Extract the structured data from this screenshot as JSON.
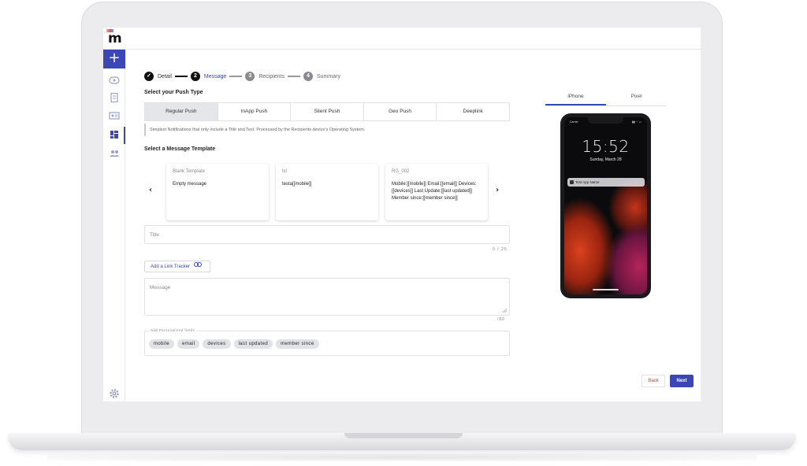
{
  "brand": {
    "logo_letter": "m",
    "accent": "#3b47b4"
  },
  "sidebar": {
    "create_label": "+",
    "items": [
      {
        "icon": "dashboard-icon"
      },
      {
        "icon": "document-icon"
      },
      {
        "icon": "contacts-icon"
      },
      {
        "icon": "grid-icon",
        "active": true
      },
      {
        "icon": "users-icon"
      }
    ],
    "settings_icon": "gear-icon"
  },
  "stepper": {
    "steps": [
      {
        "num": "✓",
        "label": "Detail",
        "state": "done"
      },
      {
        "num": "2",
        "label": "Message",
        "state": "active"
      },
      {
        "num": "3",
        "label": "Recipients",
        "state": "todo"
      },
      {
        "num": "4",
        "label": "Summary",
        "state": "todo"
      }
    ]
  },
  "push_type": {
    "heading": "Select your Push Type",
    "tabs": [
      "Regular Push",
      "InApp Push",
      "Silent Push",
      "Geo Push",
      "Deeplink"
    ],
    "selected": "Regular Push",
    "info": "Simplest Notifications that only include a Title and Text. Processed by the Recipients device's Operating System."
  },
  "templates": {
    "heading": "Select a Message Template",
    "prev_arrow": "‹",
    "next_arrow": "›",
    "cards": [
      {
        "name": "Blank Template",
        "body": "Empty message"
      },
      {
        "name": "txt",
        "body": "testa[[mobile]]"
      },
      {
        "name": "RG_002",
        "body": "Mobile:[[mobile]] Email:[[email]] Devices:[[devices]] Last Update:[[last updated]] Member since:[[member since]]"
      }
    ]
  },
  "title_field": {
    "placeholder": "Title",
    "counter": "0 / 25"
  },
  "link_tracker": {
    "label": "Add a Link Tracker"
  },
  "message_field": {
    "placeholder": "Message",
    "counter": "/80"
  },
  "personalized": {
    "label": "Add Personalized fields",
    "chips": [
      "mobile",
      "email",
      "devices",
      "last updated",
      "member since"
    ]
  },
  "preview": {
    "tabs": [
      "iPhone",
      "Pixel"
    ],
    "selected": "iPhone",
    "carrier": "Carrier",
    "status": "▮▮ ◠ ▭",
    "time": "15:52",
    "date": "Sunday, March 28",
    "notification": "Test App Name"
  },
  "actions": {
    "back": "Back",
    "next": "Next"
  }
}
